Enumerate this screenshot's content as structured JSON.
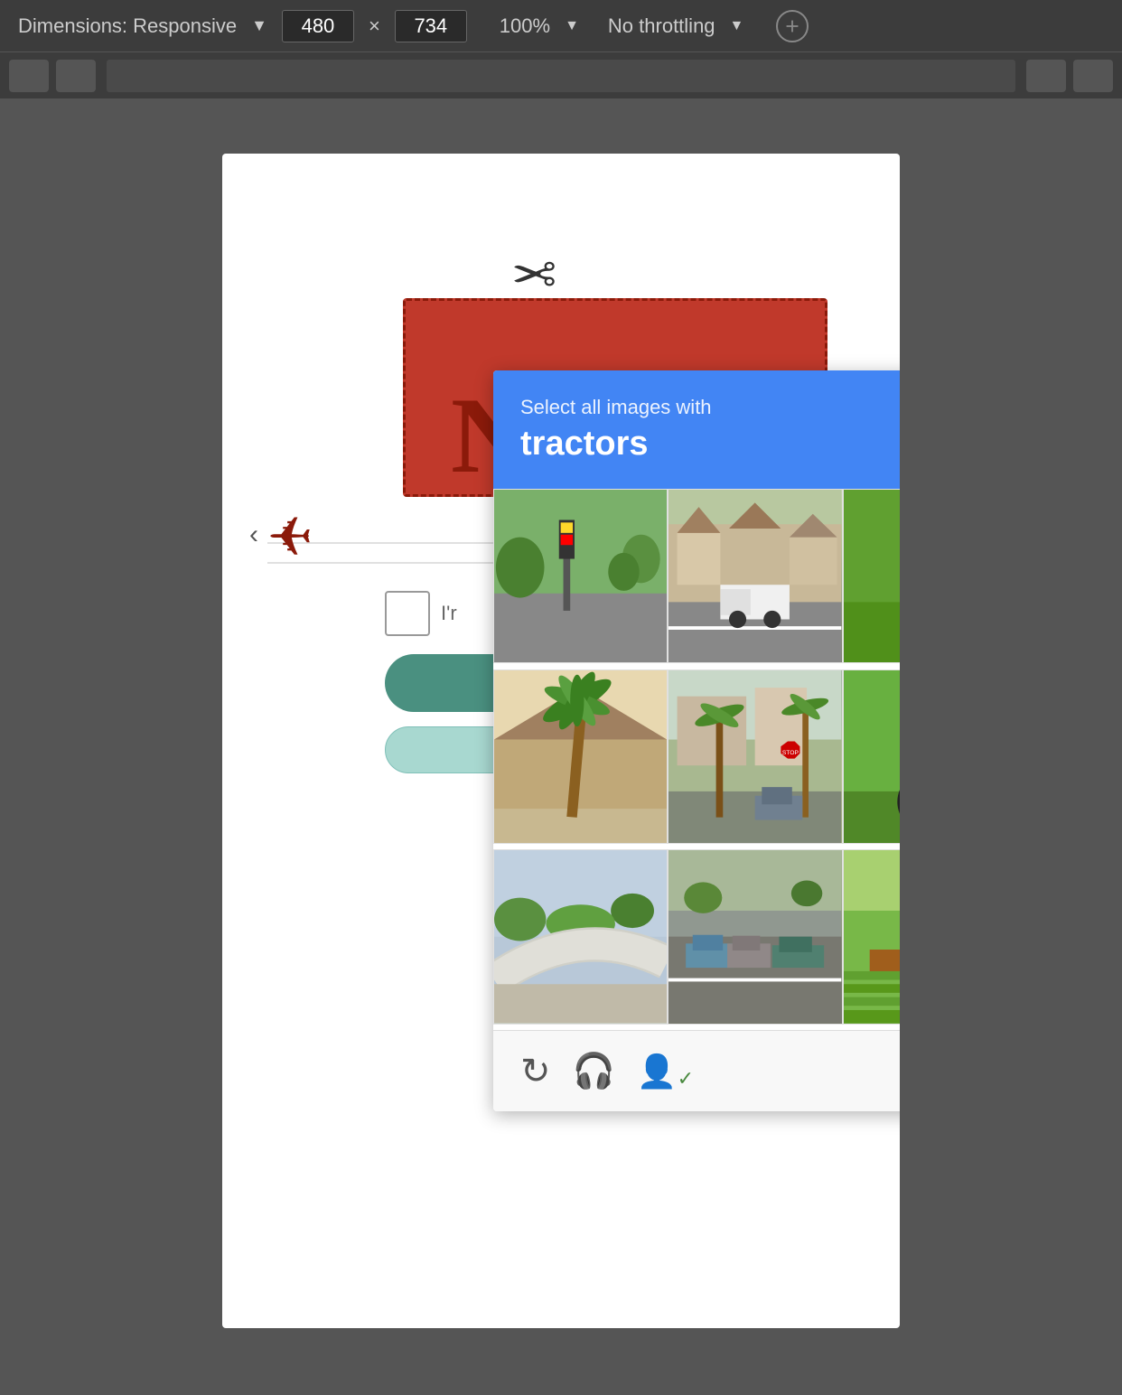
{
  "toolbar": {
    "dimensions_label": "Dimensions: Responsive",
    "dimensions_dropdown_arrow": "▼",
    "width_value": "480",
    "height_value": "734",
    "cross": "×",
    "zoom_label": "100%",
    "zoom_arrow": "▼",
    "throttle_label": "No throttling",
    "throttle_arrow": "▼"
  },
  "captcha": {
    "header_sub": "Select all images with",
    "header_main": "tractors",
    "footer_icons": {
      "refresh": "↺",
      "headphone": "🎧",
      "person": "👤"
    }
  },
  "images": [
    {
      "id": 1,
      "desc": "Street with traffic light and trees",
      "class": "img-street-light"
    },
    {
      "id": 2,
      "desc": "Road with white truck and suburban houses",
      "class": "img-road-truck"
    },
    {
      "id": 3,
      "desc": "Red tractor on green lawn",
      "class": "img-tractor-red"
    },
    {
      "id": 4,
      "desc": "Palm tree with house roof",
      "class": "img-palm-house"
    },
    {
      "id": 5,
      "desc": "Street view with palm trees",
      "class": "img-street-palms"
    },
    {
      "id": 6,
      "desc": "Green tractor on field",
      "class": "img-tractor-green"
    },
    {
      "id": 7,
      "desc": "Bridge curve aerial view",
      "class": "img-bridge-curve"
    },
    {
      "id": 8,
      "desc": "Street with parked cars",
      "class": "img-street-cars"
    },
    {
      "id": 9,
      "desc": "Red tractor in green field",
      "class": "img-tractor-field"
    }
  ]
}
